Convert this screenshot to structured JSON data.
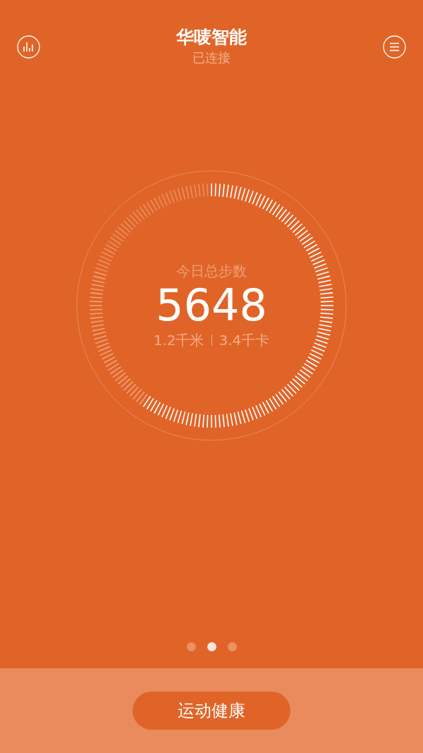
{
  "header": {
    "title": "华唛智能",
    "subtitle": "已连接"
  },
  "steps": {
    "label": "今日总步数",
    "count": "5648",
    "distance": "1.2千米",
    "calories": "3.4千卡"
  },
  "pages": [
    {
      "selected": false
    },
    {
      "selected": true
    },
    {
      "selected": false
    }
  ],
  "bottom_button": "运动健康"
}
